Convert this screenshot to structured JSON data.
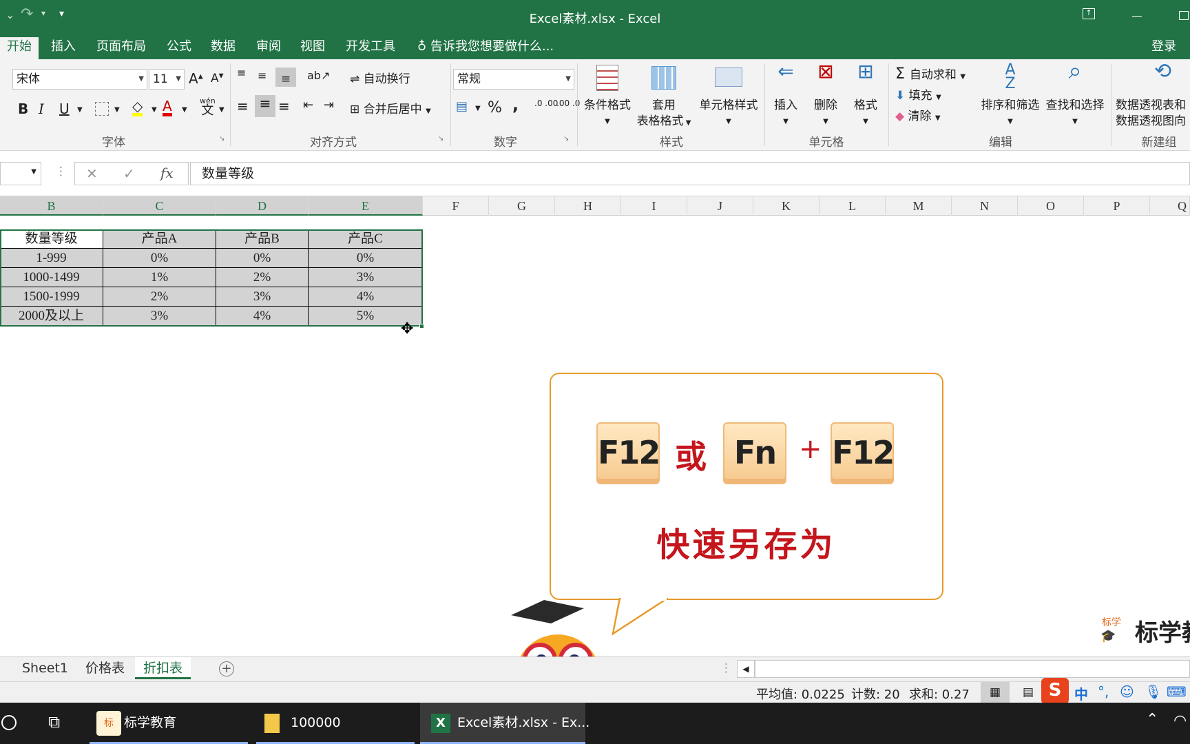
{
  "window": {
    "title": "Excel素材.xlsx - Excel",
    "signin": "登录"
  },
  "tabs": [
    "开始",
    "插入",
    "页面布局",
    "公式",
    "数据",
    "审阅",
    "视图",
    "开发工具"
  ],
  "tellme": "告诉我您想要做什么...",
  "font": {
    "name": "宋体",
    "size": "11",
    "bold": "B",
    "italic": "I",
    "underline": "U",
    "phonetic": "wén",
    "phonetic_char": "文",
    "group": "字体"
  },
  "align": {
    "wrap": "自动换行",
    "merge": "合并后居中",
    "group": "对齐方式"
  },
  "number": {
    "format": "常规",
    "percent": "%",
    "comma": ",",
    "inc": ".0 .00",
    "dec": ".00 .0",
    "group": "数字"
  },
  "styles": {
    "cond": "条件格式",
    "table1": "套用",
    "table2": "表格格式",
    "cell": "单元格样式",
    "group": "样式"
  },
  "cells": {
    "insert": "插入",
    "delete": "删除",
    "format": "格式",
    "group": "单元格"
  },
  "editing": {
    "autosum": "自动求和",
    "fill": "填充",
    "clear": "清除",
    "sort": "排序和筛选",
    "find": "查找和选择",
    "group": "编辑"
  },
  "newgroup": {
    "pivot1": "数据透视表和",
    "pivot2": "数据透视图向",
    "group": "新建组"
  },
  "formula": {
    "cancel": "✕",
    "enter": "✓",
    "fx": "fx",
    "content": "数量等级"
  },
  "columns": [
    "B",
    "C",
    "D",
    "E",
    "F",
    "G",
    "H",
    "I",
    "J",
    "K",
    "L",
    "M",
    "N",
    "O",
    "P",
    "Q"
  ],
  "table": {
    "headers": [
      "数量等级",
      "产品A",
      "产品B",
      "产品C"
    ],
    "rows": [
      [
        "1-999",
        "0%",
        "0%",
        "0%"
      ],
      [
        "1000-1499",
        "1%",
        "2%",
        "3%"
      ],
      [
        "1500-1999",
        "2%",
        "3%",
        "4%"
      ],
      [
        "2000及以上",
        "3%",
        "4%",
        "5%"
      ]
    ]
  },
  "callout": {
    "key1": "F12",
    "or": "或",
    "key2": "Fn",
    "plus": "+",
    "key3": "F12",
    "caption": "快速另存为"
  },
  "watermark": {
    "small": "标学",
    "text": "标学教"
  },
  "sheets": [
    "Sheet1",
    "价格表",
    "折扣表"
  ],
  "status": {
    "avg": "平均值: 0.0225",
    "count": "计数: 20",
    "sum": "求和: 0.27",
    "ime": "中"
  },
  "taskbar": {
    "app1": "标学教育",
    "app2": "100000",
    "app3": "Excel素材.xlsx - Ex..."
  },
  "colors": {
    "excel_green": "#217346",
    "callout_border": "#e89a2c",
    "caption_red": "#c4161c",
    "key_fill": "#f6c98e"
  }
}
